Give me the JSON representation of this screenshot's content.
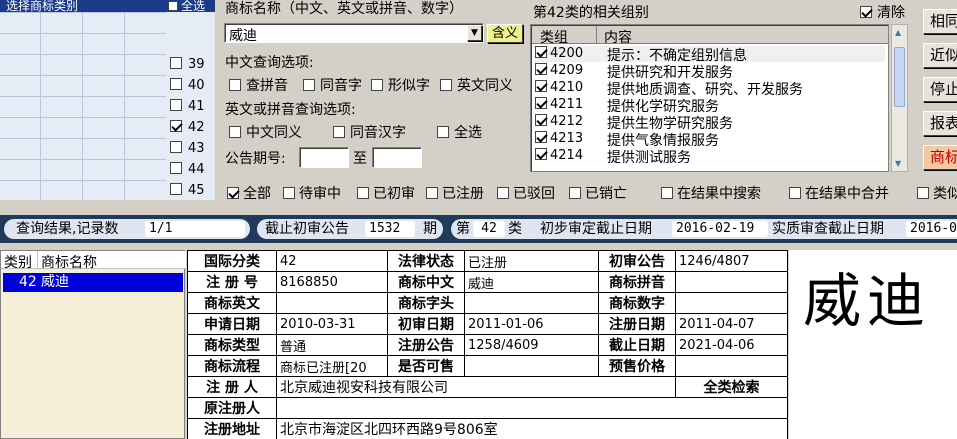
{
  "left_panel": {
    "header_label": "选择商标类别",
    "select_all_label": "全选",
    "class_numbers": [
      {
        "num": "39",
        "checked": false
      },
      {
        "num": "40",
        "checked": false
      },
      {
        "num": "41",
        "checked": false
      },
      {
        "num": "42",
        "checked": true
      },
      {
        "num": "43",
        "checked": false
      },
      {
        "num": "44",
        "checked": false
      },
      {
        "num": "45",
        "checked": false
      }
    ]
  },
  "search": {
    "name_label": "商标名称（中文、英文或拼音、数字）",
    "name_value": "威迪",
    "contains_label": "含义",
    "cn_options_label": "中文查询选项:",
    "cn_options": [
      "查拼音",
      "同音字",
      "形似字",
      "英文同义"
    ],
    "en_options_label": "英文或拼音查询选项:",
    "en_options": [
      "中文同义",
      "同音汉字",
      "全选"
    ],
    "period_label": "公告期号:",
    "period_to": "至",
    "period_from_value": "",
    "period_to_value": ""
  },
  "groups": {
    "title": "第42类的相关组别",
    "clear_label": "清除",
    "col_group": "类组",
    "col_content": "内容",
    "rows": [
      {
        "code": "4200",
        "text": "提示：不确定组别信息"
      },
      {
        "code": "4209",
        "text": "提供研究和开发服务"
      },
      {
        "code": "4210",
        "text": "提供地质调查、研究、开发服务"
      },
      {
        "code": "4211",
        "text": "提供化学研究服务"
      },
      {
        "code": "4212",
        "text": "提供生物学研究服务"
      },
      {
        "code": "4213",
        "text": "提供气象情报服务"
      },
      {
        "code": "4214",
        "text": "提供测试服务"
      }
    ]
  },
  "right_buttons": [
    "相同",
    "近似",
    "停止",
    "报表",
    "商标"
  ],
  "filters": {
    "items": [
      {
        "label": "全部",
        "checked": true
      },
      {
        "label": "待审中",
        "checked": false
      },
      {
        "label": "已初审",
        "checked": false
      },
      {
        "label": "已注册",
        "checked": false
      },
      {
        "label": "已驳回",
        "checked": false
      },
      {
        "label": "已销亡",
        "checked": false
      },
      {
        "label": "在结果中搜索",
        "checked": false
      },
      {
        "label": "在结果中合并",
        "checked": false
      },
      {
        "label": "类似",
        "checked": false
      }
    ]
  },
  "status": {
    "result_label": "查询结果,记录数",
    "result_value": "1/1",
    "cutoff_label": "截止初审公告",
    "cutoff_value": "1532",
    "cutoff_unit": "期",
    "class_prefix": "第",
    "class_value": "42",
    "class_suffix": "类",
    "prelim_label": "初步审定截止日期",
    "prelim_value": "2016-02-19",
    "substantive_label": "实质审查截止日期",
    "substantive_value": "2016-0"
  },
  "results": {
    "col_class": "类别",
    "col_name": "商标名称",
    "rows": [
      {
        "class": "42",
        "name": "威迪"
      }
    ]
  },
  "detail": {
    "intl_class_label": "国际分类",
    "intl_class": "42",
    "legal_status_label": "法律状态",
    "legal_status": "已注册",
    "prelim_pub_label": "初审公告",
    "prelim_pub": "1246/4807",
    "reg_no_label": "注 册 号",
    "reg_no": "8168850",
    "cn_name_label": "商标中文",
    "cn_name": "威迪",
    "pinyin_label": "商标拼音",
    "pinyin": "",
    "en_name_label": "商标英文",
    "en_name": "",
    "initial_label": "商标字头",
    "initial": "",
    "digits_label": "商标数字",
    "digits": "",
    "apply_date_label": "申请日期",
    "apply_date": "2010-03-31",
    "prelim_date_label": "初审日期",
    "prelim_date": "2011-01-06",
    "reg_date_label": "注册日期",
    "reg_date": "2011-04-07",
    "type_label": "商标类型",
    "type": "普通",
    "reg_pub_label": "注册公告",
    "reg_pub": "1258/4609",
    "expiry_label": "截止日期",
    "expiry": "2021-04-06",
    "flow_label": "商标流程",
    "flow": "商标已注册[20",
    "for_sale_label": "是否可售",
    "for_sale": "",
    "pre_price_label": "预售价格",
    "pre_price": "",
    "registrant_label": "注 册 人",
    "registrant": "北京威迪视安科技有限公司",
    "all_class_search": "全类检索",
    "orig_registrant_label": "原注册人",
    "orig_registrant": "",
    "address_label": "注册地址",
    "address": "北京市海淀区北四环西路9号806室"
  },
  "logo_text": "威迪"
}
